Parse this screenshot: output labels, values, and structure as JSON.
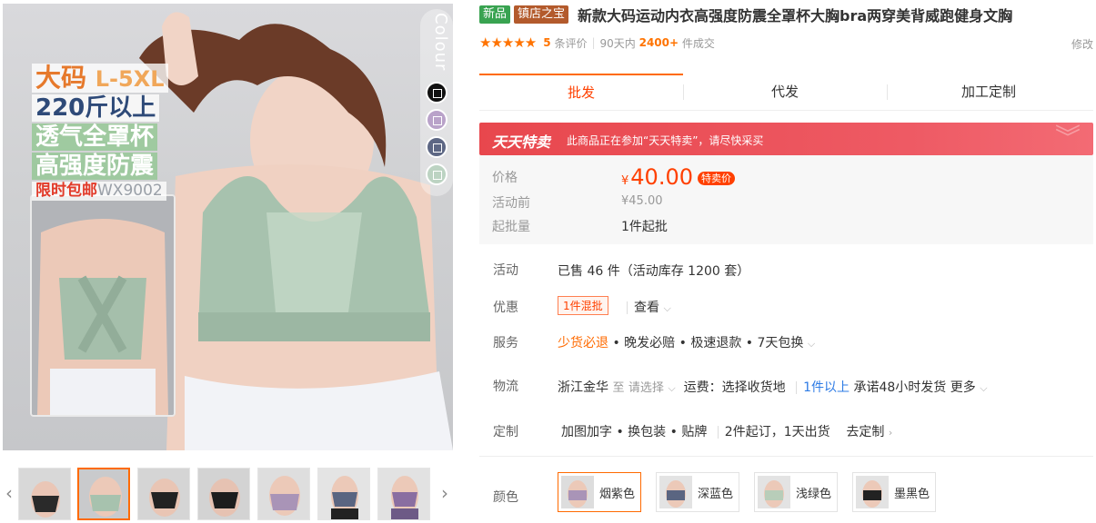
{
  "gallery": {
    "promo": {
      "size_label": "大码",
      "size_range": "L-5XL",
      "weight": "220斤以上",
      "feature1": "透气全罩杯",
      "feature2": "高强度防震",
      "code_label": "限时包邮",
      "code": "WX9002"
    },
    "colour_label": "Colour",
    "thumbnails": [
      {
        "name": "thumb-1"
      },
      {
        "name": "thumb-2"
      },
      {
        "name": "thumb-3"
      },
      {
        "name": "thumb-4"
      },
      {
        "name": "thumb-5"
      },
      {
        "name": "thumb-6"
      },
      {
        "name": "thumb-7"
      }
    ],
    "prev_icon": "chevron-left-icon",
    "next_icon": "chevron-right-icon",
    "swatch_colors": [
      "#111111",
      "#b9a2c9",
      "#5d6784",
      "#bcd3c2"
    ]
  },
  "product": {
    "badge_new": "新品",
    "badge_shop": "镇店之宝",
    "title": "新款大码运动内衣高强度防震全罩杯大胸bra两穿美背威跑健身文胸",
    "rating_count": "5",
    "rating_unit": "条评价",
    "period": "90天内",
    "sold": "2400+",
    "sold_unit": "件成交",
    "edit": "修改"
  },
  "tabs": [
    "批发",
    "代发",
    "加工定制"
  ],
  "deal": {
    "logo": "天天特卖",
    "note": "此商品正在参加“天天特卖”，请尽快采买"
  },
  "pricing": {
    "price_label": "价格",
    "currency": "¥",
    "price": "40.00",
    "sale_tag": "特卖价",
    "orig_label": "活动前",
    "orig_price": "¥45.00",
    "moq_label": "起批量",
    "moq": "1件起批"
  },
  "details": {
    "activity_label": "活动",
    "activity": "已售 46 件（活动库存 1200 套）",
    "discount_label": "优惠",
    "discount_tag": "1件混批",
    "discount_view": "查看",
    "service_label": "服务",
    "service_highlight": "少货必退",
    "service_rest": "• 晚发必赔 • 极速退款 • 7天包换",
    "logistics_label": "物流",
    "logistics_from": "浙江金华",
    "logistics_to": "至",
    "logistics_select": "请选择",
    "logistics_fee": "运费：选择收货地",
    "logistics_qty": "1件以上",
    "logistics_promise": "承诺48小时发货",
    "logistics_more": "更多",
    "custom_label": "定制",
    "custom_items": "加图加字 • 换包装 • 贴牌",
    "custom_moq": "2件起订，1天出货",
    "custom_link": "去定制"
  },
  "colors": {
    "label": "颜色",
    "options": [
      {
        "name": "烟紫色",
        "swatch": "#a994b7"
      },
      {
        "name": "深蓝色",
        "swatch": "#5a6581"
      },
      {
        "name": "浅绿色",
        "swatch": "#b8cdb9"
      },
      {
        "name": "墨黑色",
        "swatch": "#222222"
      }
    ]
  }
}
